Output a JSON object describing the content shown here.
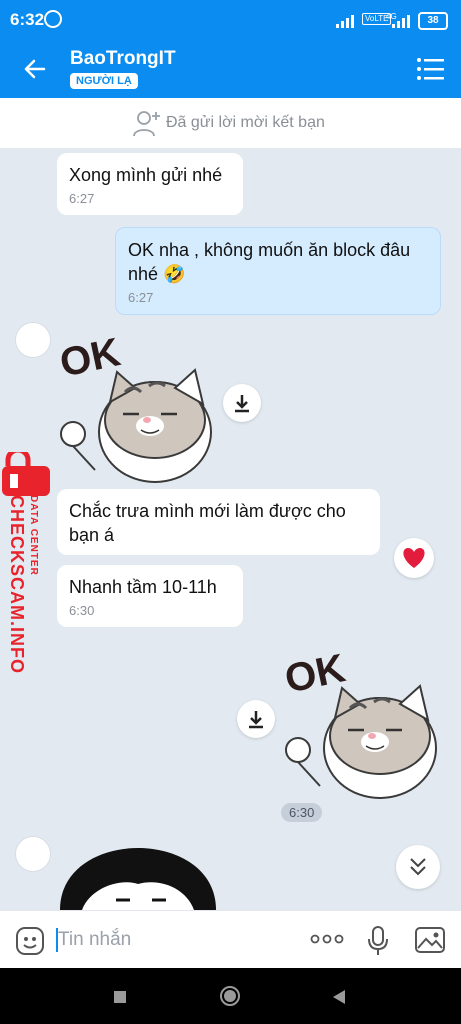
{
  "status_bar": {
    "time": "6:32",
    "volte": "VoLTE",
    "network": "4G",
    "battery": "38"
  },
  "header": {
    "contact_name": "BaoTrongIT",
    "badge": "NGƯỜI LẠ"
  },
  "friend_request": {
    "text": "Đã gửi lời mời kết bạn"
  },
  "messages": [
    {
      "text": "Xong mình gửi nhé",
      "time": "6:27"
    },
    {
      "text": "OK nha , không muốn ăn block đâu nhé 🤣",
      "time": "6:27"
    },
    {
      "text": "Chắc trưa mình mới làm được cho bạn á"
    },
    {
      "text": "Nhanh tầm 10-11h",
      "time": "6:30"
    }
  ],
  "sticker_label": "OK",
  "sticker_time": "6:30",
  "watermark": {
    "main": "CHECKSCAM.INFO",
    "sub": "DATA CENTER"
  },
  "input": {
    "placeholder": "Tin nhắn"
  },
  "colors": {
    "primary": "#0a8cf0",
    "background": "#e2e9f1",
    "own_bubble": "#d5ebfe",
    "watermark": "#e8232b"
  }
}
